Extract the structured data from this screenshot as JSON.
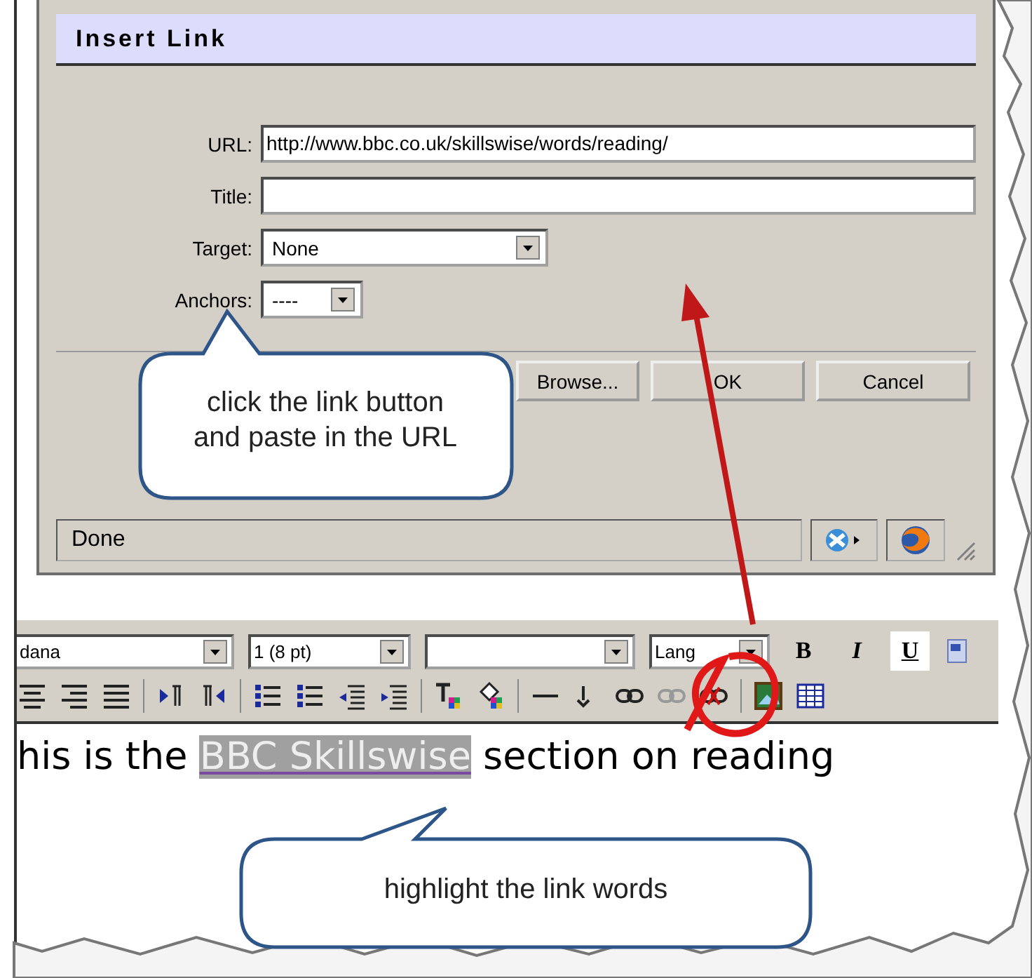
{
  "dialog": {
    "title": "Insert Link",
    "fields": [
      {
        "label": "URL:",
        "kind": "text",
        "value": "http://www.bbc.co.uk/skillswise/words/reading/"
      },
      {
        "label": "Title:",
        "kind": "text"
      },
      {
        "label": "Target:",
        "kind": "select",
        "value": "None"
      },
      {
        "label": "Anchors:",
        "kind": "select",
        "value": "----"
      }
    ],
    "buttons": [
      "Browse...",
      "OK",
      "Cancel"
    ],
    "status_bar": {
      "text": "Done"
    }
  },
  "toolbar": {
    "selects": [
      {
        "kind": "font",
        "value": "dana"
      },
      {
        "kind": "size",
        "value": "1 (8 pt)"
      },
      {
        "kind": "style"
      },
      {
        "kind": "language",
        "value": "Lang"
      }
    ],
    "format_buttons": [
      {
        "label": "B",
        "selected": false
      },
      {
        "label": "I",
        "selected": false
      },
      {
        "label": "U",
        "selected": true
      }
    ]
  },
  "editor": {
    "text_before": "his is the",
    "selected_text": "BBC Skillswise",
    "text_after": "section on reading"
  },
  "callouts": [
    {
      "text": "click the link button and paste in the URL"
    },
    {
      "text": "highlight the link words"
    }
  ]
}
